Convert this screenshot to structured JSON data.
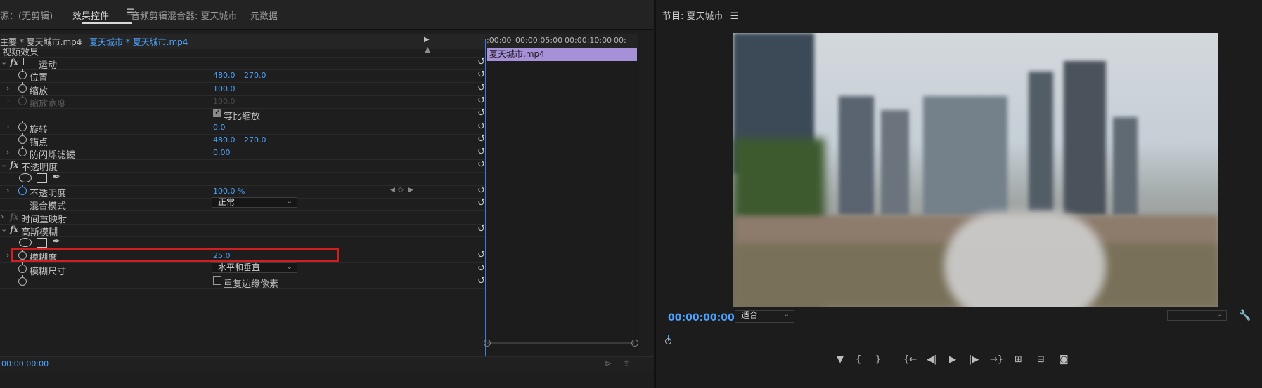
{
  "tabs": {
    "source": "源：(无剪辑)",
    "effect_controls": "效果控件",
    "audio_mixer": "音频剪辑混合器: 夏天城市",
    "metadata": "元数据"
  },
  "clipbar": {
    "master": "主要 * 夏天城市.mp4",
    "clip": "夏天城市 * 夏天城市.mp4"
  },
  "ruler": {
    "t0": ":00:00",
    "t1": "00:00:05:00",
    "t2": "00:00:10:00",
    "t3": "00:"
  },
  "ec_clip_name": "夏天城市.mp4",
  "section_video": "视频效果",
  "motion": {
    "name": "运动",
    "position_label": "位置",
    "position_x": "480.0",
    "position_y": "270.0",
    "scale_label": "缩放",
    "scale_value": "100.0",
    "scale_width_label": "缩放宽度",
    "scale_width_value": "100.0",
    "uniform_scale_label": "等比缩放",
    "rotation_label": "旋转",
    "rotation_value": "0.0",
    "anchor_label": "锚点",
    "anchor_x": "480.0",
    "anchor_y": "270.0",
    "flicker_label": "防闪烁滤镜",
    "flicker_value": "0.00"
  },
  "opacity": {
    "name": "不透明度",
    "opacity_label": "不透明度",
    "opacity_value": "100.0 %",
    "blend_label": "混合模式",
    "blend_value": "正常"
  },
  "time_remap": "时间重映射",
  "gaussian": {
    "name": "高斯模糊",
    "blurriness_label": "模糊度",
    "blurriness_value": "25.0",
    "dimensions_label": "模糊尺寸",
    "dimensions_value": "水平和垂直",
    "repeat_edge_label": "重复边缘像素"
  },
  "ec_timecode": "00:00:00:00",
  "program": {
    "title": "节目: 夏天城市",
    "timecode": "00:00:00:00",
    "fit": "适合"
  },
  "colors": {
    "accent": "#4ba3ff",
    "clip": "#a690d8",
    "highlight": "#d21e1e"
  }
}
